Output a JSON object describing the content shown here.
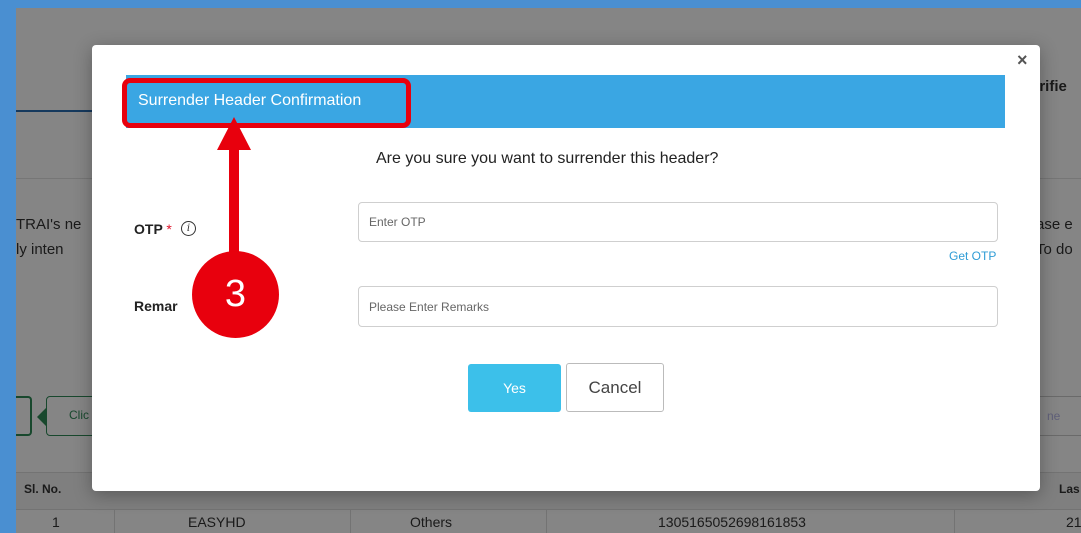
{
  "background": {
    "verified_fragment": "erifie",
    "notice_left_line1": "TRAI's ne",
    "notice_left_line2": "ly inten",
    "notice_right_line1": "ase e",
    "notice_right_line2": "To do",
    "click_tag": "Clic",
    "search_fragment": "ne",
    "table": {
      "headers": [
        "Sl. No.",
        "Las"
      ],
      "row": [
        "1",
        "EASYHD",
        "Others",
        "1305165052698161853",
        "21"
      ]
    }
  },
  "modal": {
    "close_symbol": "×",
    "title": "Surrender Header Confirmation",
    "question": "Are you sure you want to surrender this header?",
    "otp": {
      "label": "OTP",
      "required_mark": "*",
      "info_symbol": "i",
      "placeholder": "Enter OTP",
      "value": "",
      "get_otp": "Get OTP"
    },
    "remarks": {
      "label": "Remar",
      "placeholder": "Please Enter Remarks",
      "value": ""
    },
    "yes_label": "Yes",
    "cancel_label": "Cancel"
  },
  "annotation": {
    "step_number": "3",
    "color": "#e8000d"
  },
  "colors": {
    "header_blue": "#3aa6e3",
    "yes_button": "#3cc0ea",
    "link_blue": "#2e9cd6",
    "frame_blue": "#4a8fd1"
  }
}
